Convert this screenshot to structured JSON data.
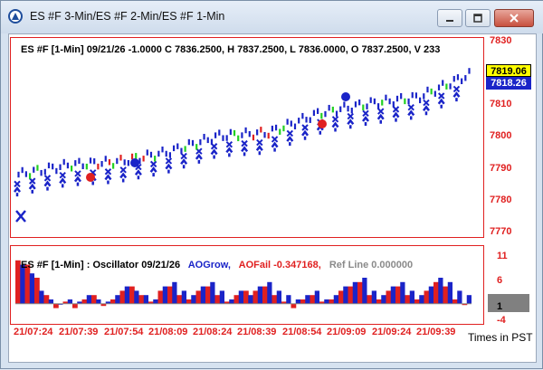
{
  "window": {
    "title": "ES #F 3-Min/ES #F 2-Min/ES #F 1-Min"
  },
  "icons": {
    "app": "app-triangle-icon",
    "minimize": "minimize-icon",
    "maximize": "maximize-icon",
    "close": "close-icon"
  },
  "price_panel": {
    "header": "ES #F [1-Min] 09/21/26  -1.0000 C 7836.2500, H 7837.2500, L 7836.0000, O 7837.2500, V 233",
    "axis_labels": [
      "7830",
      "7820",
      "7810",
      "7800",
      "7790",
      "7780",
      "7770"
    ],
    "last_price_tags": [
      "7819.06",
      "7818.26"
    ]
  },
  "osc_panel": {
    "title": "ES #F [1-Min] : Oscillator 09/21/26",
    "series": [
      {
        "label": "AOGrow,",
        "color": "#1a24c8"
      },
      {
        "label": "AOFail -0.347168,",
        "color": "#e02020"
      },
      {
        "label": "Ref Line 0.000000",
        "color": "#8a8a8a"
      }
    ],
    "axis_labels": [
      "11",
      "6",
      "1",
      "-4"
    ]
  },
  "time_axis": {
    "labels": [
      "21/07:24",
      "21/07:39",
      "21/07:54",
      "21/08:09",
      "21/08:24",
      "21/08:39",
      "21/08:54",
      "21/09:09",
      "21/09:24",
      "21/09:39"
    ],
    "timezone_label": "Times in PST"
  },
  "colors": {
    "bull": "#1a24c8",
    "bear": "#e02020",
    "up_bar": "#22d022",
    "highlight": "#ffff00"
  },
  "chart_data": [
    {
      "type": "line",
      "title": "ES #F [1-Min] 09/21/26",
      "ylim": [
        7770,
        7830
      ],
      "x": [
        "21/07:24",
        "21/07:39",
        "21/07:54",
        "21/08:09",
        "21/08:24",
        "21/08:39",
        "21/08:54",
        "21/09:09",
        "21/09:24",
        "21/09:39"
      ],
      "series": [
        {
          "name": "",
          "values": [
            7788,
            7791,
            7792,
            7795,
            7800,
            7801,
            7807,
            7810,
            7812,
            7819
          ]
        }
      ]
    },
    {
      "type": "bar",
      "title": "ES #F [1-Min] : Oscillator 09/21/26",
      "ylim": [
        -4,
        11
      ],
      "series": [
        {
          "name": "AOGrow",
          "values": [
            9,
            7,
            3,
            1,
            0,
            1,
            0.5,
            2,
            1,
            0.5,
            2,
            4,
            3,
            2,
            1,
            4,
            5,
            3,
            2,
            4,
            5,
            3,
            1,
            3,
            2,
            4,
            5,
            3,
            2,
            1,
            2,
            3,
            1,
            2,
            4,
            5,
            6,
            3,
            2,
            4,
            5,
            3,
            2,
            4,
            6,
            5,
            3,
            2
          ]
        },
        {
          "name": "AOFail -0.347168",
          "values": [
            10,
            9,
            6,
            2,
            -1,
            0.5,
            -1,
            1,
            2,
            -0.5,
            1,
            3,
            4,
            2,
            0.5,
            3,
            4,
            2,
            1,
            3,
            4,
            2,
            0.5,
            2,
            3,
            3,
            4,
            2,
            0.5,
            -1,
            1,
            2,
            0.5,
            1,
            3,
            4,
            5,
            2,
            1,
            3,
            4,
            2,
            1,
            3,
            5,
            4,
            1,
            -0.3
          ]
        },
        {
          "name": "Ref Line 0.000000",
          "values": [
            0
          ]
        }
      ]
    }
  ]
}
